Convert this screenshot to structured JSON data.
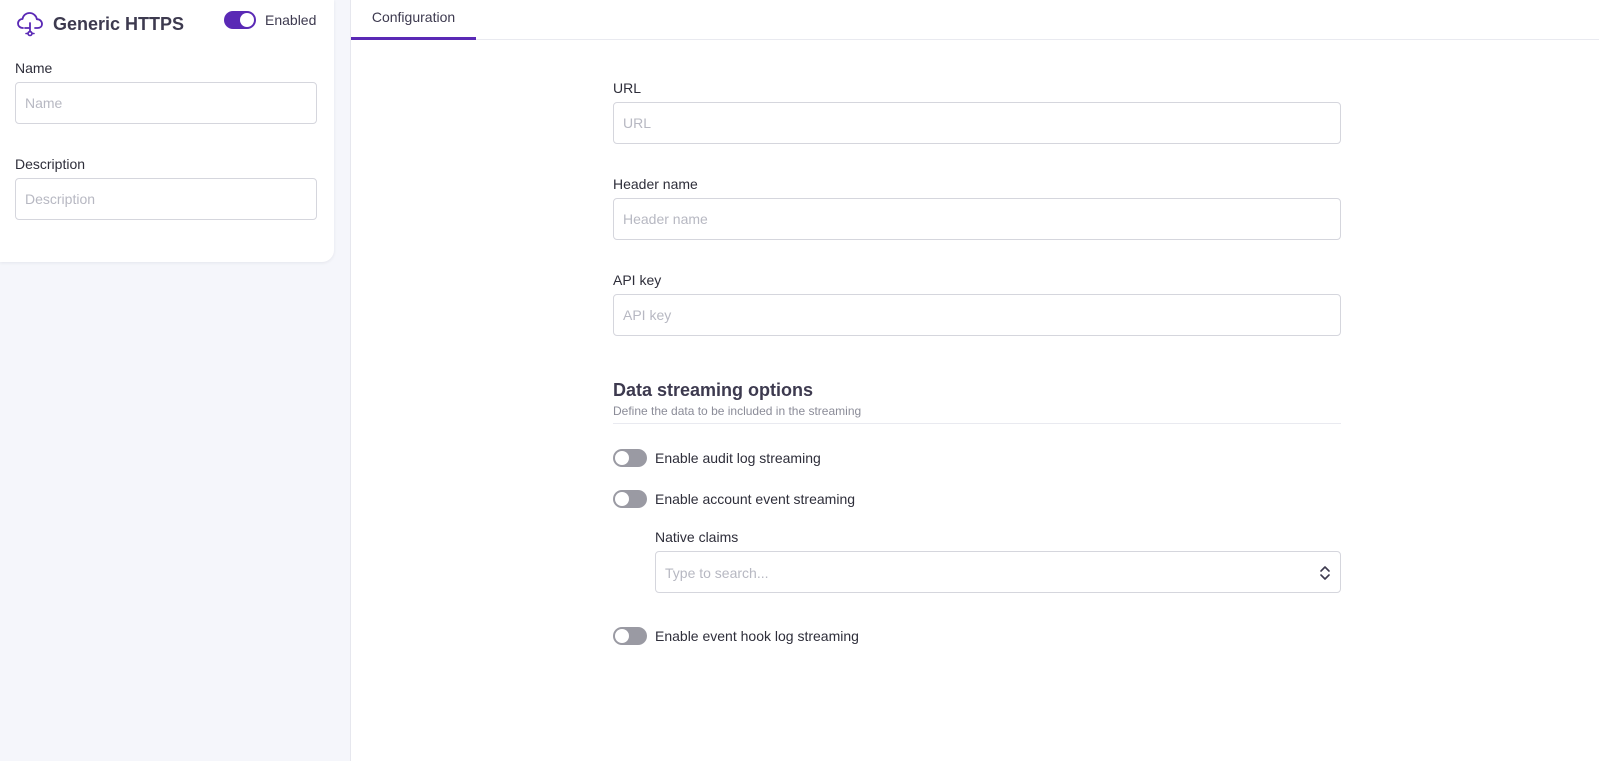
{
  "card": {
    "title": "Generic HTTPS",
    "icon": "cloud-upload-icon",
    "status_label": "Enabled",
    "status_on": true,
    "name_label": "Name",
    "name_placeholder": "Name",
    "name_value": "",
    "description_label": "Description",
    "description_placeholder": "Description",
    "description_value": ""
  },
  "tabs": [
    {
      "label": "Configuration",
      "active": true
    }
  ],
  "config": {
    "url_label": "URL",
    "url_placeholder": "URL",
    "header_label": "Header name",
    "header_placeholder": "Header name",
    "apikey_label": "API key",
    "apikey_placeholder": "API key"
  },
  "streaming": {
    "title": "Data streaming options",
    "subtitle": "Define the data to be included in the streaming",
    "audit_label": "Enable audit log streaming",
    "audit_on": false,
    "account_label": "Enable account event streaming",
    "account_on": false,
    "claims_label": "Native claims",
    "claims_placeholder": "Type to search...",
    "hook_label": "Enable event hook log streaming",
    "hook_on": false
  },
  "colors": {
    "accent": "#5a29b5",
    "switch_off": "#9a9aa3",
    "page_background": "#f5f6fb"
  }
}
